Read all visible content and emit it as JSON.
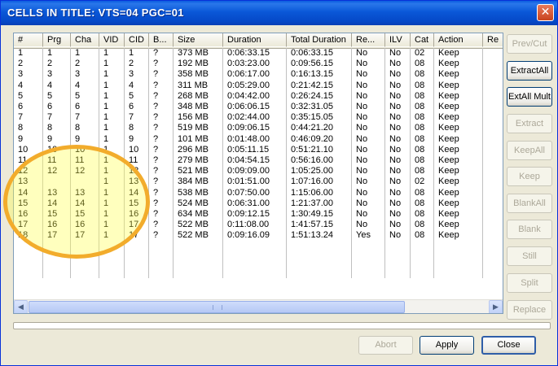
{
  "window": {
    "title": "CELLS IN TITLE: VTS=04 PGC=01",
    "close_glyph": "✕"
  },
  "columns": [
    "#",
    "Prg",
    "Cha",
    "VID",
    "CID",
    "B...",
    "Size",
    "Duration",
    "Total Duration",
    "Re...",
    "ILV",
    "Cat",
    "Action",
    "Re"
  ],
  "rows": [
    [
      "1",
      "1",
      "1",
      "1",
      "1",
      "?",
      "373 MB",
      "0:06:33.15",
      "0:06:33.15",
      "No",
      "No",
      "02",
      "Keep"
    ],
    [
      "2",
      "2",
      "2",
      "1",
      "2",
      "?",
      "192 MB",
      "0:03:23.00",
      "0:09:56.15",
      "No",
      "No",
      "08",
      "Keep"
    ],
    [
      "3",
      "3",
      "3",
      "1",
      "3",
      "?",
      "358 MB",
      "0:06:17.00",
      "0:16:13.15",
      "No",
      "No",
      "08",
      "Keep"
    ],
    [
      "4",
      "4",
      "4",
      "1",
      "4",
      "?",
      "311 MB",
      "0:05:29.00",
      "0:21:42.15",
      "No",
      "No",
      "08",
      "Keep"
    ],
    [
      "5",
      "5",
      "5",
      "1",
      "5",
      "?",
      "268 MB",
      "0:04:42.00",
      "0:26:24.15",
      "No",
      "No",
      "08",
      "Keep"
    ],
    [
      "6",
      "6",
      "6",
      "1",
      "6",
      "?",
      "348 MB",
      "0:06:06.15",
      "0:32:31.05",
      "No",
      "No",
      "08",
      "Keep"
    ],
    [
      "7",
      "7",
      "7",
      "1",
      "7",
      "?",
      "156 MB",
      "0:02:44.00",
      "0:35:15.05",
      "No",
      "No",
      "08",
      "Keep"
    ],
    [
      "8",
      "8",
      "8",
      "1",
      "8",
      "?",
      "519 MB",
      "0:09:06.15",
      "0:44:21.20",
      "No",
      "No",
      "08",
      "Keep"
    ],
    [
      "9",
      "9",
      "9",
      "1",
      "9",
      "?",
      "101 MB",
      "0:01:48.00",
      "0:46:09.20",
      "No",
      "No",
      "08",
      "Keep"
    ],
    [
      "10",
      "10",
      "10",
      "1",
      "10",
      "?",
      "296 MB",
      "0:05:11.15",
      "0:51:21.10",
      "No",
      "No",
      "08",
      "Keep"
    ],
    [
      "11",
      "11",
      "11",
      "1",
      "11",
      "?",
      "279 MB",
      "0:04:54.15",
      "0:56:16.00",
      "No",
      "No",
      "08",
      "Keep"
    ],
    [
      "12",
      "12",
      "12",
      "1",
      "12",
      "?",
      "521 MB",
      "0:09:09.00",
      "1:05:25.00",
      "No",
      "No",
      "08",
      "Keep"
    ],
    [
      "13",
      "",
      "",
      "1",
      "13",
      "?",
      "384 MB",
      "0:01:51.00",
      "1:07:16.00",
      "No",
      "No",
      "02",
      "Keep"
    ],
    [
      "14",
      "13",
      "13",
      "1",
      "14",
      "?",
      "538 MB",
      "0:07:50.00",
      "1:15:06.00",
      "No",
      "No",
      "08",
      "Keep"
    ],
    [
      "15",
      "14",
      "14",
      "1",
      "15",
      "?",
      "524 MB",
      "0:06:31.00",
      "1:21:37.00",
      "No",
      "No",
      "08",
      "Keep"
    ],
    [
      "16",
      "15",
      "15",
      "1",
      "16",
      "?",
      "634 MB",
      "0:09:12.15",
      "1:30:49.15",
      "No",
      "No",
      "08",
      "Keep"
    ],
    [
      "17",
      "16",
      "16",
      "1",
      "17",
      "?",
      "522 MB",
      "0:11:08.00",
      "1:41:57.15",
      "No",
      "No",
      "08",
      "Keep"
    ],
    [
      "18",
      "17",
      "17",
      "1",
      "17",
      "?",
      "522 MB",
      "0:09:16.09",
      "1:51:13.24",
      "Yes",
      "No",
      "08",
      "Keep"
    ]
  ],
  "side_buttons": [
    {
      "label": "Prev/Cut",
      "enabled": false
    },
    {
      "label": "ExtractAll",
      "enabled": true
    },
    {
      "label": "ExtAll Mult",
      "enabled": true
    },
    {
      "label": "Extract",
      "enabled": false
    },
    {
      "label": "KeepAll",
      "enabled": false
    },
    {
      "label": "Keep",
      "enabled": false
    },
    {
      "label": "BlankAll",
      "enabled": false
    },
    {
      "label": "Blank",
      "enabled": false
    },
    {
      "label": "Still",
      "enabled": false
    },
    {
      "label": "Split",
      "enabled": false
    },
    {
      "label": "Replace",
      "enabled": false
    }
  ],
  "bottom_buttons": {
    "abort": {
      "label": "Abort",
      "enabled": false
    },
    "apply": {
      "label": "Apply",
      "enabled": true
    },
    "close": {
      "label": "Close",
      "enabled": true
    }
  },
  "scrollbar": {
    "left_glyph": "◀",
    "right_glyph": "▶"
  },
  "colors": {
    "titlebar": "#0a58d8",
    "highlight_ring": "#f2ac2c",
    "highlight_fill": "#ffff46",
    "disabled_text": "#aca899"
  }
}
